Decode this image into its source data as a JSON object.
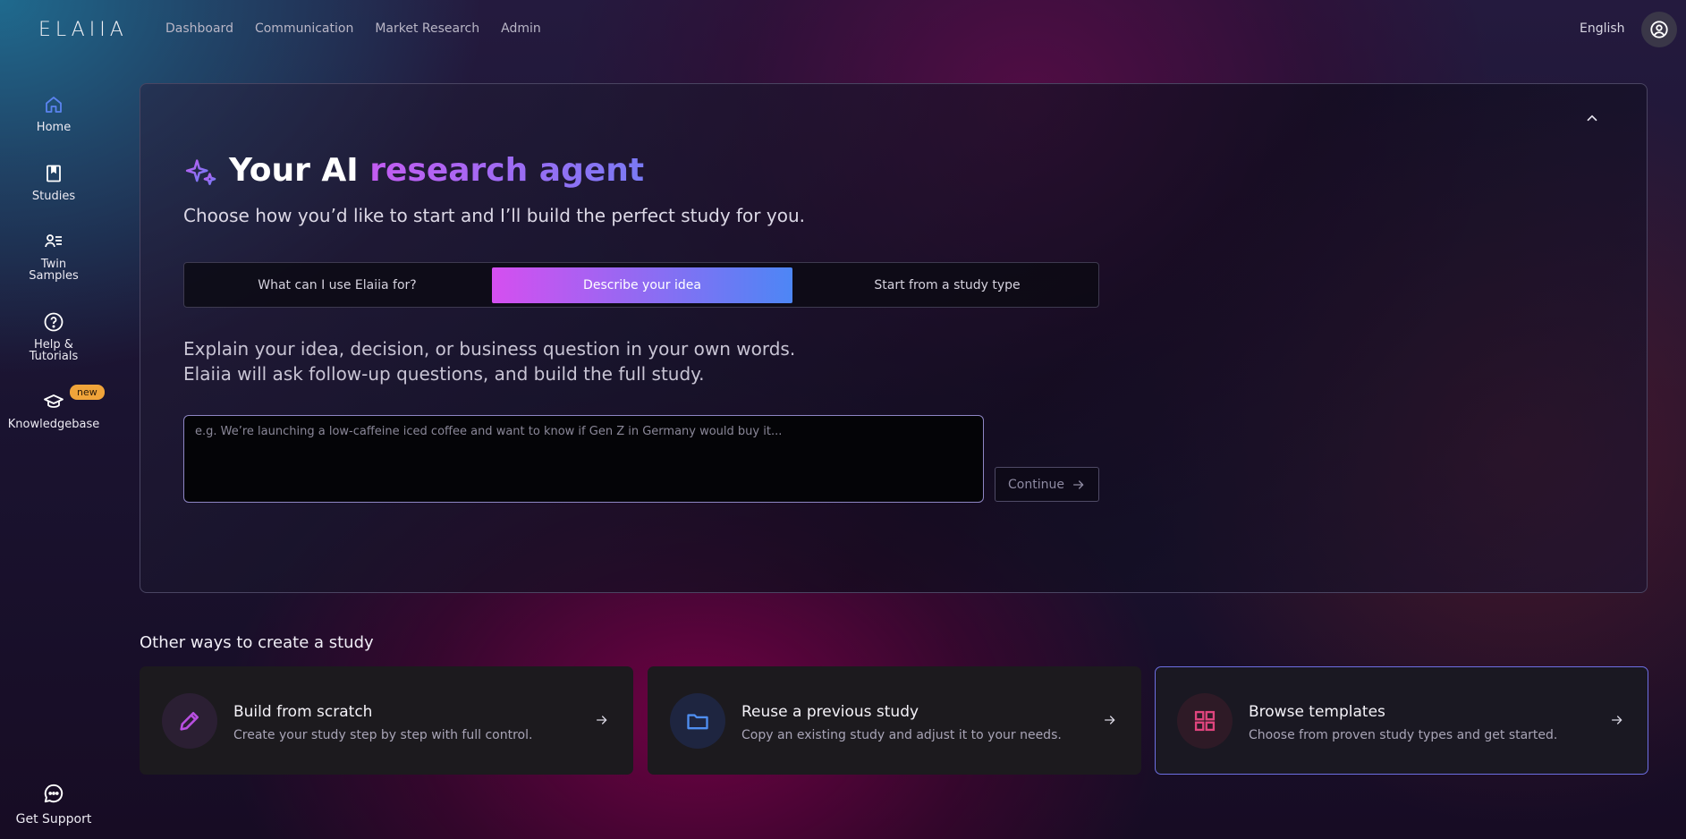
{
  "app": {
    "logo_text": "ELAIIA"
  },
  "topnav": {
    "items": [
      "Dashboard",
      "Communication",
      "Market Research",
      "Admin"
    ],
    "language": "English"
  },
  "sidebar": {
    "items": [
      {
        "label": "Home",
        "icon": "home-icon"
      },
      {
        "label": "Studies",
        "icon": "book-icon"
      },
      {
        "label": "Twin Samples",
        "icon": "user-list-icon"
      },
      {
        "label": "Help & Tutorials",
        "icon": "help-circle-icon"
      },
      {
        "label": "Knowledgebase",
        "icon": "graduation-cap-icon",
        "badge": "new"
      }
    ],
    "support": {
      "label": "Get Support",
      "icon": "chat-bubble-icon"
    }
  },
  "hero": {
    "title_prefix": "Your AI",
    "title_highlight": "research agent",
    "subtitle": "Choose how you’d like to start and I’ll build the perfect study for you.",
    "tabs": [
      {
        "label": "What can I use Elaiia for?",
        "active": false
      },
      {
        "label": "Describe your idea",
        "active": true
      },
      {
        "label": "Start from a study type",
        "active": false
      }
    ],
    "explain_line1": "Explain your idea, decision, or business question in your own words.",
    "explain_line2": "Elaiia will ask follow-up questions, and build the full study.",
    "input_placeholder": "e.g. We’re launching a low-caffeine iced coffee and want to know if Gen Z in Germany would buy it...",
    "input_value": "",
    "continue_label": "Continue"
  },
  "other": {
    "title": "Other ways to create a study",
    "cards": [
      {
        "title": "Build from scratch",
        "desc": "Create your study step by step with full control.",
        "icon": "pencil-icon",
        "color": "#b84fe0"
      },
      {
        "title": "Reuse a previous study",
        "desc": "Copy an existing study and adjust it to your needs.",
        "icon": "folder-icon",
        "color": "#4f8ef0"
      },
      {
        "title": "Browse templates",
        "desc": "Choose from proven study types and get started.",
        "icon": "grid-icon",
        "color": "#e0457e",
        "selected": true
      }
    ]
  },
  "colors": {
    "accent_gradient_start": "#d54ff0",
    "accent_gradient_end": "#4d86f5",
    "badge": "#f0a43a",
    "selected_border": "#6d6fe4"
  }
}
